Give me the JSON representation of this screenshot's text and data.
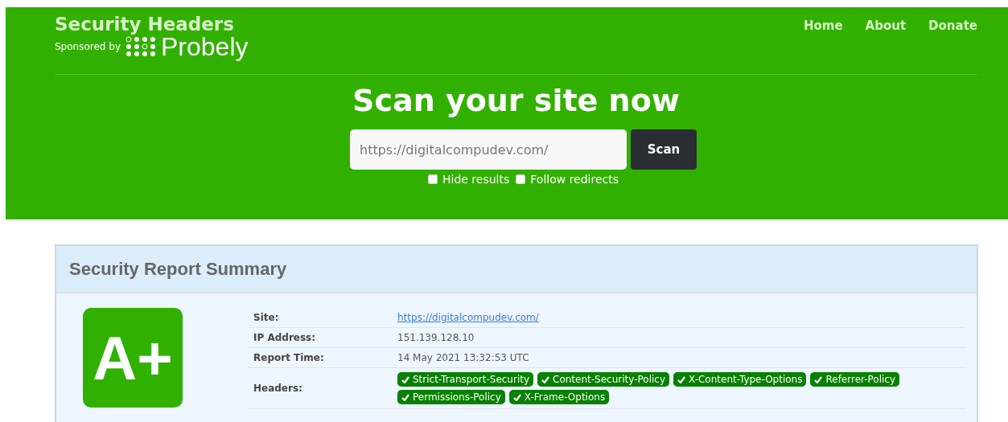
{
  "header": {
    "title": "Security Headers",
    "sponsor_label": "Sponsored by",
    "sponsor_name": "Probely",
    "nav": [
      "Home",
      "About",
      "Donate"
    ]
  },
  "scan": {
    "heading": "Scan your site now",
    "url": {
      "value": "https://digitalcompudev.com/"
    },
    "button": "Scan",
    "options": [
      {
        "label": "Hide results",
        "checked": false
      },
      {
        "label": "Follow redirects",
        "checked": false
      }
    ]
  },
  "report": {
    "title": "Security Report Summary",
    "grade": "A+",
    "rows": [
      {
        "kind": "link",
        "label": "Site:",
        "value": "https://digitalcompudev.com/"
      },
      {
        "kind": "text",
        "label": "IP Address:",
        "value": "151.139.128.10"
      },
      {
        "kind": "text",
        "label": "Report Time:",
        "value": "14 May 2021 13:32:53 UTC"
      },
      {
        "kind": "badges",
        "label": "Headers:",
        "badges": [
          "Strict-Transport-Security",
          "Content-Security-Policy",
          "X-Content-Type-Options",
          "Referrer-Policy",
          "Permissions-Policy",
          "X-Frame-Options"
        ]
      }
    ]
  }
}
